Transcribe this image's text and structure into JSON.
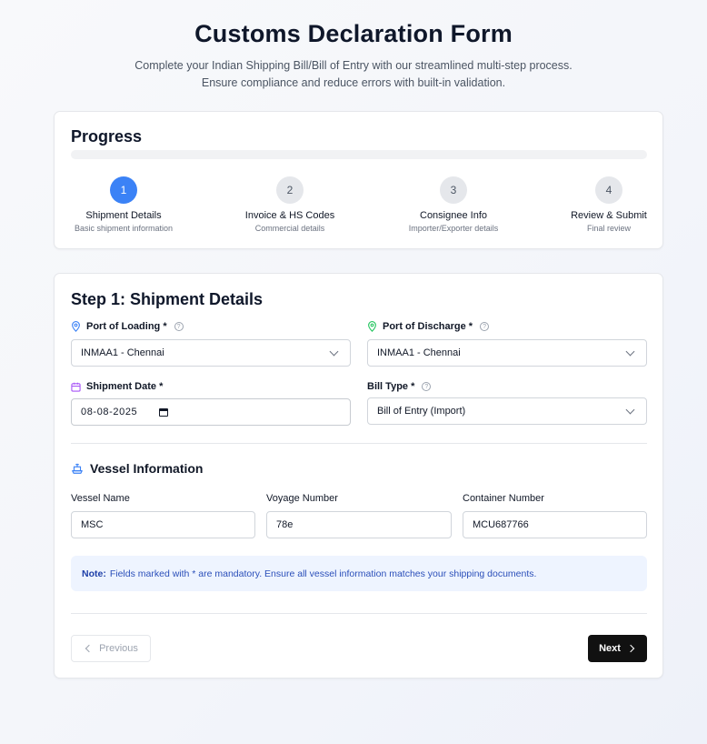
{
  "header": {
    "title": "Customs Declaration Form",
    "subtitle_line1": "Complete your Indian Shipping Bill/Bill of Entry with our streamlined multi-step process.",
    "subtitle_line2": "Ensure compliance and reduce errors with built-in validation."
  },
  "progress": {
    "title": "Progress",
    "percent": 0,
    "steps": [
      {
        "number": "1",
        "name": "Shipment Details",
        "desc": "Basic shipment information",
        "active": true
      },
      {
        "number": "2",
        "name": "Invoice & HS Codes",
        "desc": "Commercial details",
        "active": false
      },
      {
        "number": "3",
        "name": "Consignee Info",
        "desc": "Importer/Exporter details",
        "active": false
      },
      {
        "number": "4",
        "name": "Review & Submit",
        "desc": "Final review",
        "active": false
      }
    ]
  },
  "form": {
    "title": "Step 1: Shipment Details",
    "port_of_loading": {
      "label": "Port of Loading *",
      "value": "INMAA1 - Chennai",
      "icon": "map-pin-icon",
      "icon_color": "#3b82f6"
    },
    "port_of_discharge": {
      "label": "Port of Discharge *",
      "value": "INMAA1 - Chennai",
      "icon": "map-pin-icon",
      "icon_color": "#22c55e"
    },
    "shipment_date": {
      "label": "Shipment Date *",
      "value": "08-08-2025",
      "icon": "calendar-icon",
      "icon_color": "#a855f7"
    },
    "bill_type": {
      "label": "Bill Type *",
      "value": "Bill of Entry (Import)"
    },
    "help_glyph": "?",
    "vessel_section": {
      "title": "Vessel Information",
      "icon": "ship-icon",
      "icon_color": "#3b82f6"
    },
    "vessel_name": {
      "label": "Vessel Name",
      "value": "MSC"
    },
    "voyage_number": {
      "label": "Voyage Number",
      "value": "78e"
    },
    "container_number": {
      "label": "Container Number",
      "value": "MCU687766"
    },
    "note": {
      "prefix": "Note:",
      "text": "Fields marked with * are mandatory. Ensure all vessel information matches your shipping documents."
    },
    "buttons": {
      "previous": "Previous",
      "next": "Next"
    }
  }
}
